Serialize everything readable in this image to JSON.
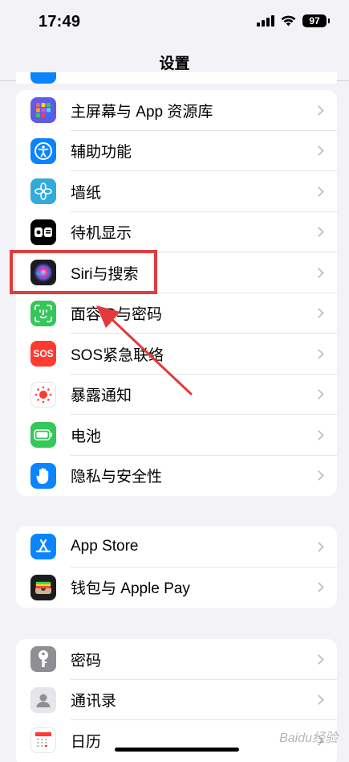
{
  "status_bar": {
    "time": "17:49",
    "battery": "97"
  },
  "nav": {
    "title": "设置"
  },
  "groups": [
    {
      "items": [
        {
          "label": "主屏幕与 App 资源库",
          "icon": "home-screen-icon",
          "color": "#5e5ce6"
        },
        {
          "label": "辅助功能",
          "icon": "accessibility-icon",
          "color": "#0a84ff"
        },
        {
          "label": "墙纸",
          "icon": "wallpaper-icon",
          "color": "#34aadc"
        },
        {
          "label": "待机显示",
          "icon": "standby-icon",
          "color": "#000000"
        },
        {
          "label": "Siri与搜索",
          "icon": "siri-icon",
          "color": "#1c1c1e"
        },
        {
          "label": "面容ID与密码",
          "icon": "face-id-icon",
          "color": "#34c759"
        },
        {
          "label": "SOS紧急联络",
          "icon": "sos-icon",
          "icon_text": "SOS",
          "color": "#ff3b30"
        },
        {
          "label": "暴露通知",
          "icon": "exposure-icon",
          "color": "#ffffff"
        },
        {
          "label": "电池",
          "icon": "battery-icon",
          "color": "#34c759"
        },
        {
          "label": "隐私与安全性",
          "icon": "hand-icon",
          "color": "#0a84ff"
        }
      ]
    },
    {
      "items": [
        {
          "label": "App Store",
          "icon": "app-store-icon",
          "color": "#0a84ff"
        },
        {
          "label": "钱包与 Apple Pay",
          "icon": "wallet-icon",
          "color": "#1c1c1e"
        }
      ]
    },
    {
      "items": [
        {
          "label": "密码",
          "icon": "key-icon",
          "color": "#8e8e93"
        },
        {
          "label": "通讯录",
          "icon": "contacts-icon",
          "color": "#c7c7cc"
        },
        {
          "label": "日历",
          "icon": "calendar-icon",
          "color": "#ffffff"
        }
      ]
    }
  ],
  "annotation": {
    "highlight_color": "#e23b3b",
    "target": "Siri与搜索"
  },
  "watermark": "Baidu经验"
}
